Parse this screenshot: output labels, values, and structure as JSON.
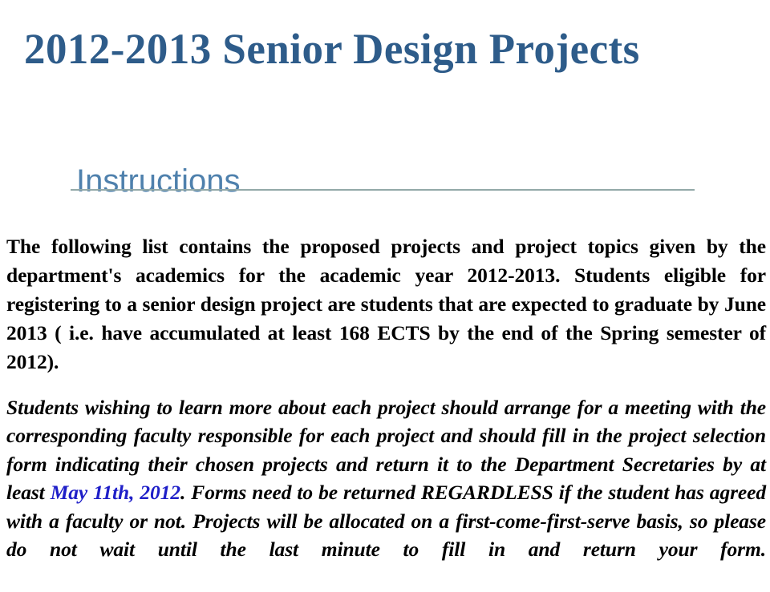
{
  "slide": {
    "title": "2012-2013 Senior Design Projects",
    "title_color": "#2E5C8A"
  },
  "section": {
    "heading": "Instructions",
    "heading_color": "#4F81AD",
    "rule_color": "#93A9A8"
  },
  "content": {
    "paragraph_one": "The following list contains the proposed projects and project topics given by the department's academics for the academic year 2012-2013. Students eligible for registering to a senior design project are students that are expected to graduate by June 2013 ( i.e. have accumulated at least 168 ECTS by the end of the Spring semester of 2012).",
    "paragraph_two_part_one": "Students wishing to learn more about each project should arrange for a meeting with the corresponding faculty responsible for each project and should fill in the project selection form indicating their chosen projects and return it to the Department Secretaries by at least ",
    "deadline_date": "May 11th, 2012",
    "deadline_date_color": "#1F1FC8",
    "paragraph_two_part_two": ". Forms need to be returned REGARDLESS if the student has agreed with a faculty or not. Projects will be allocated on a first-come-first-serve basis, so please do not wait until the last minute to fill in and return your form."
  }
}
